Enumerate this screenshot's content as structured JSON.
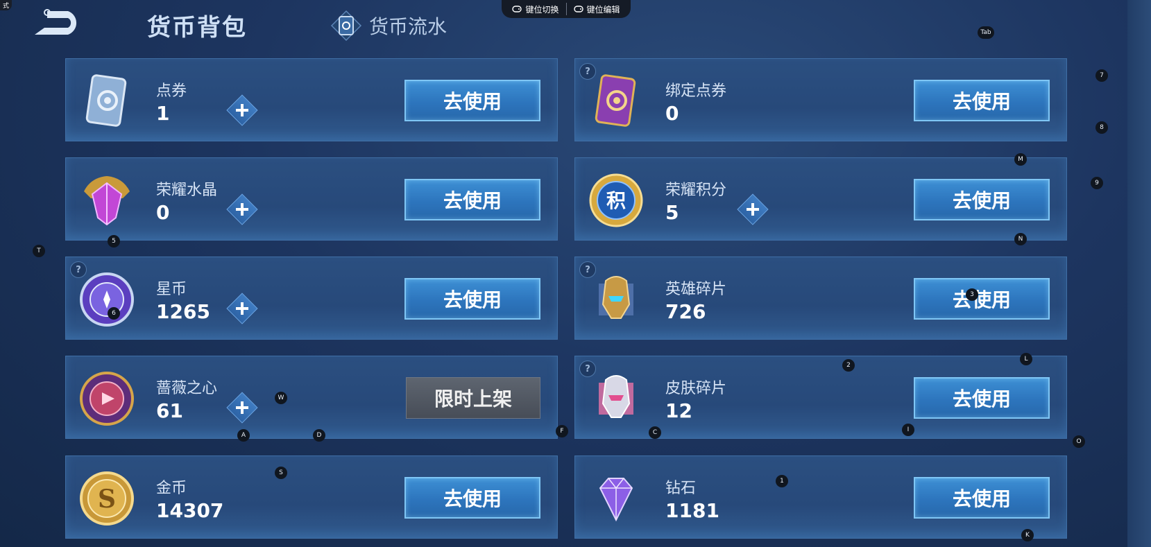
{
  "corner_tag": "式",
  "header": {
    "title": "货币背包",
    "flow_tab": "货币流水"
  },
  "key_bar": {
    "switch_label": "键位切换",
    "edit_label": "键位编辑"
  },
  "button_labels": {
    "use": "去使用",
    "limited": "限时上架"
  },
  "cards": [
    {
      "name": "点券",
      "value": "1"
    },
    {
      "name": "绑定点券",
      "value": "0"
    },
    {
      "name": "荣耀水晶",
      "value": "0"
    },
    {
      "name": "荣耀积分",
      "value": "5"
    },
    {
      "name": "星币",
      "value": "1265"
    },
    {
      "name": "英雄碎片",
      "value": "726"
    },
    {
      "name": "蔷薇之心",
      "value": "61"
    },
    {
      "name": "皮肤碎片",
      "value": "12"
    },
    {
      "name": "金币",
      "value": "14307"
    },
    {
      "name": "钻石",
      "value": "1181"
    }
  ],
  "key_hints": [
    "Tab",
    "7",
    "8",
    "M",
    "9",
    "N",
    "L",
    "O",
    "K",
    "T",
    "5",
    "6",
    "W",
    "A",
    "D",
    "F",
    "S",
    "C",
    "I",
    "2",
    "1",
    "3"
  ],
  "colors": {
    "background": "#1d3560",
    "card_border": "#3f6ea5",
    "use_button": "#2d75bd",
    "limited_button": "#4f5560"
  }
}
